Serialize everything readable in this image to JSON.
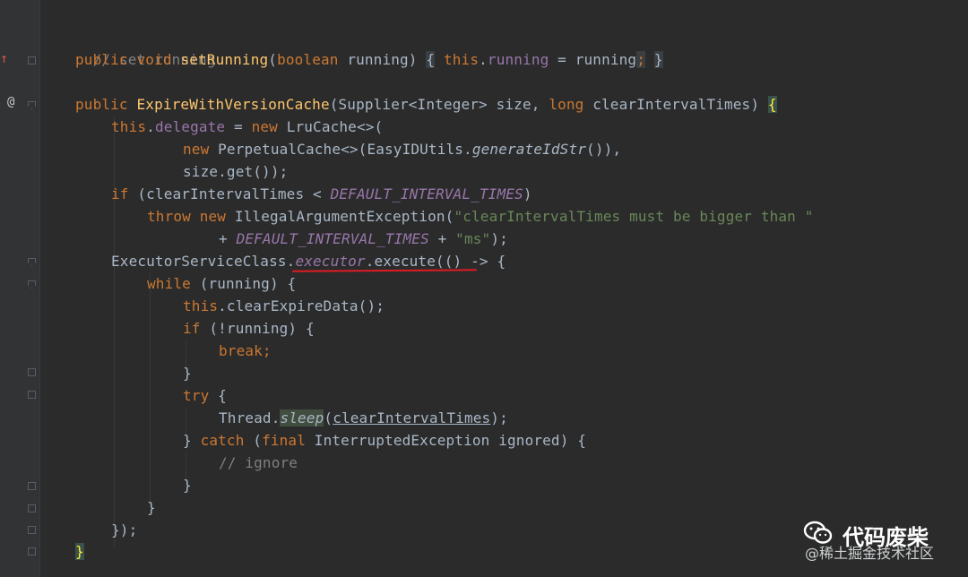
{
  "gutter": {
    "breakpoint_icon": "↑",
    "override_icon": "@"
  },
  "code": {
    "l1_comment": "// set running",
    "l2_public": "public",
    "l2_void": "void",
    "l2_name": "setRunning",
    "l2_open": "(",
    "l2_boolean": "boolean",
    "l2_param": " running) ",
    "l2_brace_open": "{",
    "l2_this": "this",
    "l2_dot": ".",
    "l2_field": "running",
    "l2_assign": " = running",
    "l2_semi": ";",
    "l2_brace_close": "}",
    "l4_public": "public",
    "l4_ctor": "ExpireWithVersionCache",
    "l4_params1": "(Supplier<Integer> size, ",
    "l4_long": "long",
    "l4_params2": " clearIntervalTimes) ",
    "l4_brace": "{",
    "l5_this": "this",
    "l5_dot": ".",
    "l5_field": "delegate",
    "l5_assign": " = ",
    "l5_new": "new",
    "l5_rest": " LruCache<>(",
    "l6_new": "new",
    "l6_rest": " PerpetualCache<>(EasyIDUtils.",
    "l6_static": "generateIdStr",
    "l6_close": "()),",
    "l7_text": "size.get());",
    "l8_if": "if",
    "l8_text": " (clearIntervalTimes < ",
    "l8_const": "DEFAULT_INTERVAL_TIMES",
    "l8_close": ")",
    "l9_throw": "throw",
    "l9_new": "new",
    "l9_rest": " IllegalArgumentException(",
    "l9_str": "\"clearIntervalTimes must be bigger than \"",
    "l10_plus": "+ ",
    "l10_const": "DEFAULT_INTERVAL_TIMES",
    "l10_plus2": " + ",
    "l10_str": "\"ms\"",
    "l10_close": ");",
    "l11_class": "ExecutorServiceClass.",
    "l11_field": "executor",
    "l11_rest": ".execute(() -> {",
    "l12_while": "while",
    "l12_rest": " (running) {",
    "l13_this": "this",
    "l13_rest": ".clearExpireData();",
    "l14_if": "if",
    "l14_rest": " (!running) {",
    "l15_break": "break;",
    "l16_close": "}",
    "l17_try": "try",
    "l17_rest": " {",
    "l18_thread": "Thread.",
    "l18_sleep": "sleep",
    "l18_open": "(",
    "l18_arg": "clearIntervalTimes",
    "l18_close": ");",
    "l19_close": "} ",
    "l19_catch": "catch",
    "l19_sp": " (",
    "l19_final": "final",
    "l19_rest": " InterruptedException ignored) {",
    "l20_comment": "// ignore",
    "l21_close": "}",
    "l22_close": "}",
    "l23_close": "});",
    "l24_close": "}"
  },
  "watermark": {
    "brand": "代码废柴",
    "sub": "@稀土掘金技术社区"
  }
}
